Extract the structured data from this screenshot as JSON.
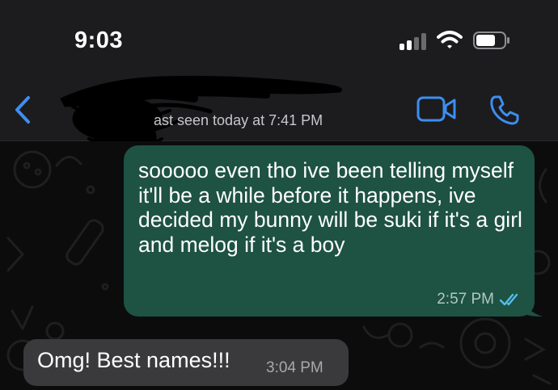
{
  "status_bar": {
    "time": "9:03"
  },
  "header": {
    "last_seen": "ast seen today at 7:41 PM"
  },
  "messages": [
    {
      "direction": "outgoing",
      "text": "sooooo even tho ive been telling myself it'll be a while before it happens, ive decided my bunny will be suki if it's a girl and melog if it's a boy",
      "time": "2:57 PM",
      "status_icon": "double-check-icon"
    },
    {
      "direction": "incoming",
      "text": "Omg! Best names!!!",
      "time": "3:04 PM"
    }
  ],
  "colors": {
    "accent": "#3d8ef0",
    "outgoing_bubble": "#1e5243",
    "incoming_bubble": "#3a3a3c",
    "header_bg": "#1c1c1e",
    "chat_bg": "#0c0c0c",
    "read_ticks": "#53bdeb"
  },
  "icons": [
    "signal-bars-icon",
    "wifi-icon",
    "battery-icon",
    "back-chevron-icon",
    "video-call-icon",
    "phone-call-icon",
    "double-check-icon"
  ]
}
